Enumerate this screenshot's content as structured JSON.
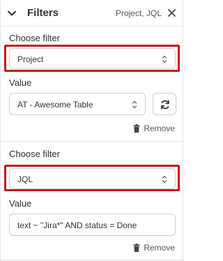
{
  "header": {
    "title": "Filters",
    "summary": "Project, JQL"
  },
  "filters": [
    {
      "choose_label": "Choose filter",
      "selected": "Project",
      "value_label": "Value",
      "value": "AT - Awesome Table",
      "remove_label": "Remove"
    },
    {
      "choose_label": "Choose filter",
      "selected": "JQL",
      "value_label": "Value",
      "value": "text ~ \"Jira*\" AND status = Done",
      "remove_label": "Remove"
    }
  ],
  "colors": {
    "highlight": "#d0141b",
    "border": "#cfcfcf"
  }
}
